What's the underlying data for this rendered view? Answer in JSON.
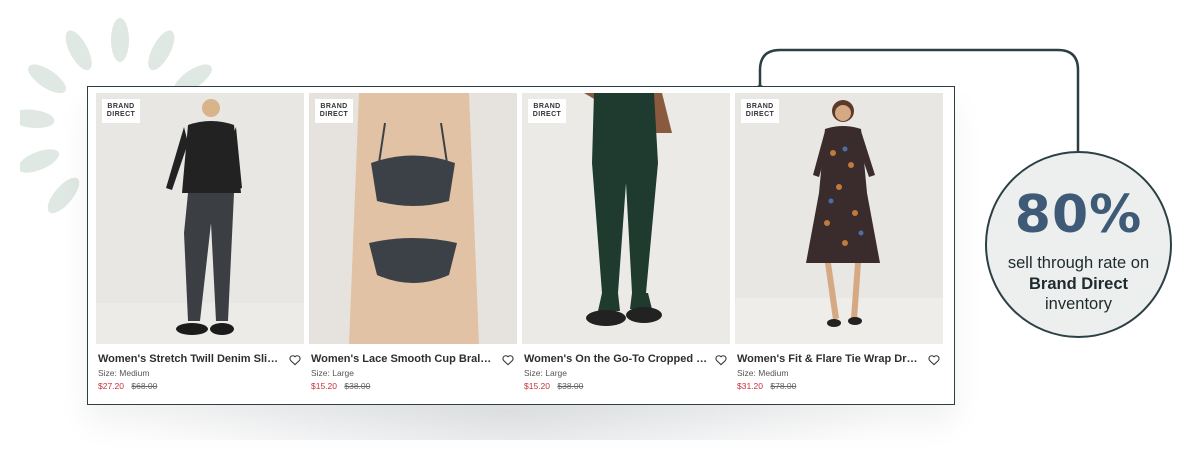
{
  "products": [
    {
      "badge_line1": "BRAND",
      "badge_line2": "DIRECT",
      "title": "Women's Stretch Twill Denim Slim ...",
      "size": "Size: Medium",
      "sale_price": "$27.20",
      "original_price": "$68.00"
    },
    {
      "badge_line1": "BRAND",
      "badge_line2": "DIRECT",
      "title": "Women's Lace Smooth Cup Bralette",
      "size": "Size: Large",
      "sale_price": "$15.20",
      "original_price": "$38.00"
    },
    {
      "badge_line1": "BRAND",
      "badge_line2": "DIRECT",
      "title": "Women's On the Go-To Cropped B...",
      "size": "Size: Large",
      "sale_price": "$15.20",
      "original_price": "$38.00"
    },
    {
      "badge_line1": "BRAND",
      "badge_line2": "DIRECT",
      "title": "Women's Fit & Flare Tie Wrap Dress",
      "size": "Size: Medium",
      "sale_price": "$31.20",
      "original_price": "$78.00"
    }
  ],
  "stat": {
    "value": "80%",
    "line1": "sell through rate on",
    "line2": "Brand Direct",
    "line3": "inventory"
  },
  "icons": {
    "favorite": "heart-outline-icon",
    "decoration": "leaf-petals-icon"
  },
  "colors": {
    "frame": "#2b3f44",
    "stat_value": "#3e5a76",
    "sale_price": "#c8303a",
    "circle_fill": "#ecefed",
    "petals": "#dfe8e3"
  }
}
